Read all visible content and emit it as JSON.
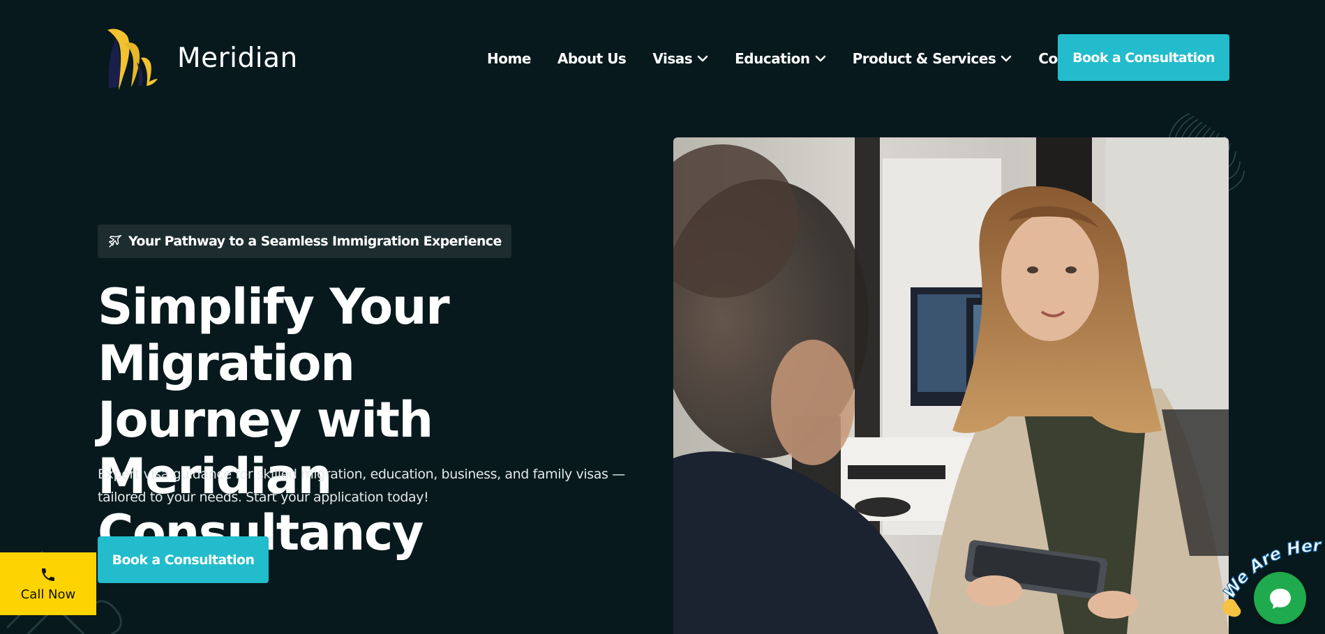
{
  "brand": {
    "name": "Meridian",
    "accent_color": "#22bccc",
    "background_color": "#07191c",
    "logo_colors": [
      "#f2c230",
      "#1a1f4a"
    ]
  },
  "nav": {
    "items": [
      {
        "label": "Home",
        "dropdown": false
      },
      {
        "label": "About Us",
        "dropdown": false
      },
      {
        "label": "Visas",
        "dropdown": true
      },
      {
        "label": "Education",
        "dropdown": true
      },
      {
        "label": "Product & Services",
        "dropdown": true
      },
      {
        "label": "Contact",
        "dropdown": false
      }
    ],
    "cta_label": "Book a Consultation"
  },
  "hero": {
    "tagline": "Your Pathway to a Seamless Immigration Experience",
    "tagline_icon": "airplane-icon",
    "title_lines": [
      "Simplify Your Migration",
      "Journey with Meridian",
      "Consultancy"
    ],
    "description": "Expert visa guidance for skilled migration, education, business, and family visas — tailored to your needs. Start your application today!",
    "cta_label": "Book a Consultation",
    "image_alt": "consultant-meeting-photo"
  },
  "call_now": {
    "label": "Call Now",
    "icon": "phone-icon",
    "color": "#fdd400"
  },
  "chat_widget": {
    "banner_text": "We Are Here!",
    "close_symbol": "✕",
    "icon": "chat-icon",
    "color": "#1faa4d"
  }
}
